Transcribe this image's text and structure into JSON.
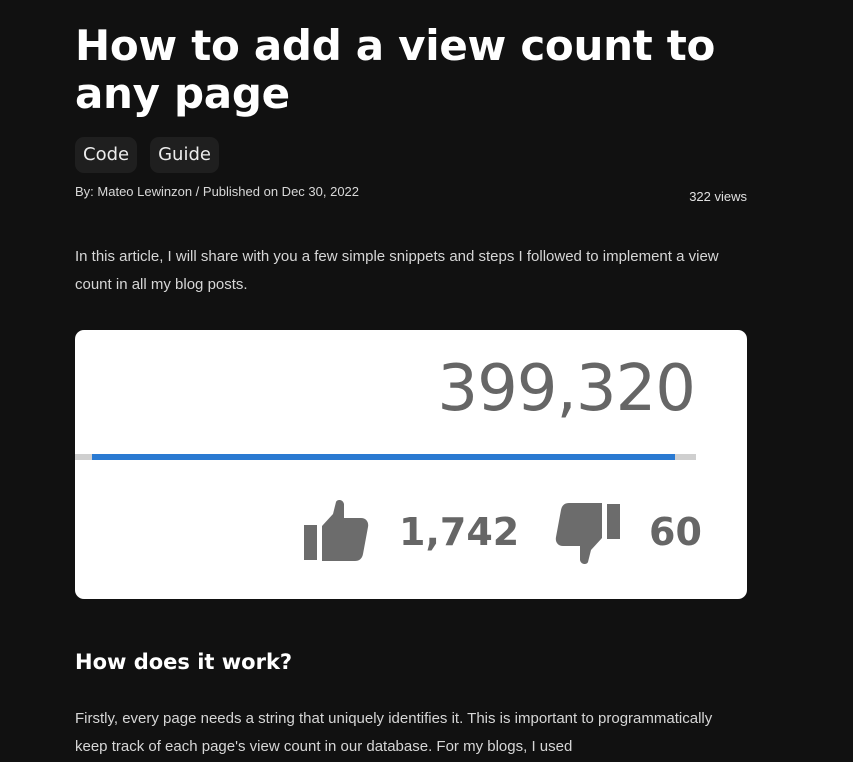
{
  "article": {
    "title": "How to add a view count to any page",
    "tags": [
      "Code",
      "Guide"
    ],
    "byline": "By: Mateo Lewinzon / Published on Dec 30, 2022",
    "views": "322 views",
    "intro": "In this article, I will share with you a few simple snippets and steps I followed to implement a view count in all my blog posts.",
    "section_heading": "How does it work?",
    "section_text": "Firstly, every page needs a string that uniquely identifies it. This is important to programmatically keep track of each page's view count in our database. For my blogs, I used"
  },
  "stats_image": {
    "view_count": "399,320",
    "like_count": "1,742",
    "dislike_count": "60",
    "like_ratio": 0.966,
    "icons": {
      "like": "thumbs-up-icon",
      "dislike": "thumbs-down-icon"
    },
    "colors": {
      "bar": "#2a7ad2",
      "text": "#666666"
    }
  }
}
